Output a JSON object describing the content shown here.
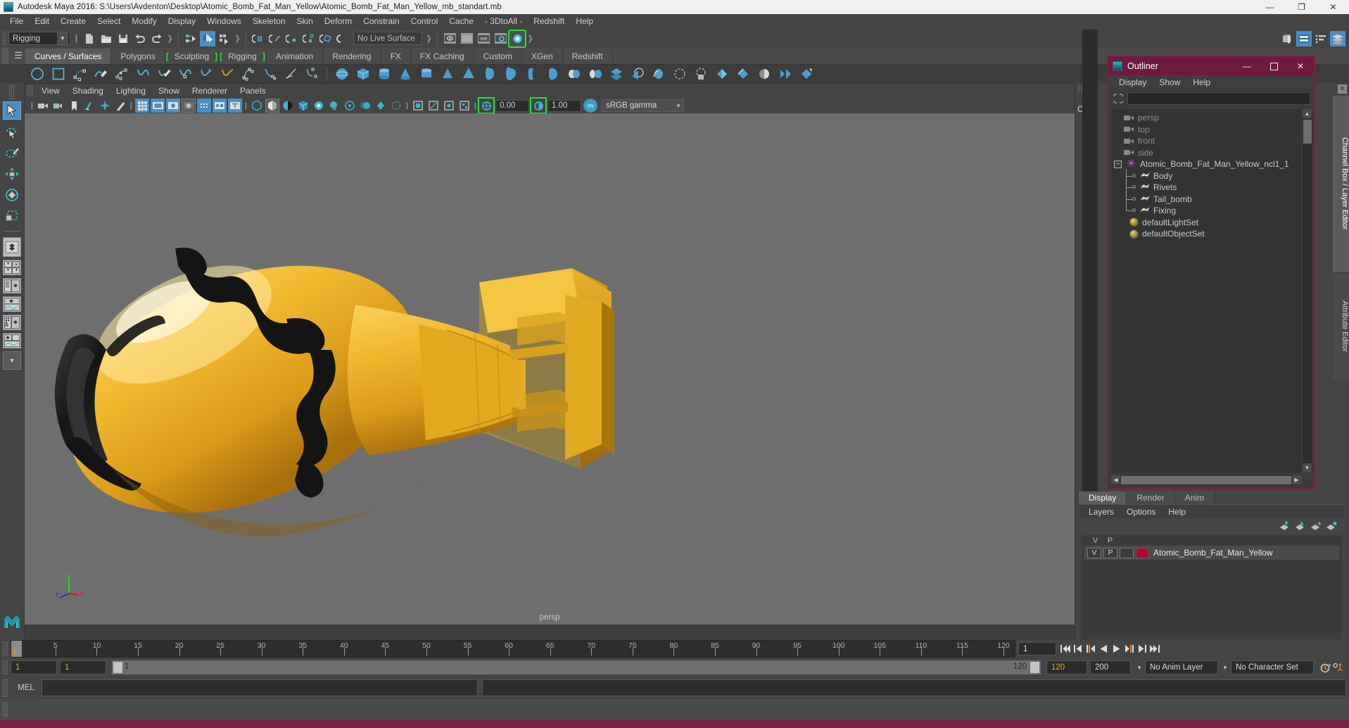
{
  "window": {
    "title": "Autodesk Maya 2016: S:\\Users\\Avdenton\\Desktop\\Atomic_Bomb_Fat_Man_Yellow\\Atomic_Bomb_Fat_Man_Yellow_mb_standart.mb",
    "icon": "maya-logo-icon",
    "minimize": "—",
    "restore": "❐",
    "close": "✕"
  },
  "menubar": {
    "items": [
      {
        "label": "File"
      },
      {
        "label": "Edit"
      },
      {
        "label": "Create"
      },
      {
        "label": "Select"
      },
      {
        "label": "Modify"
      },
      {
        "label": "Display"
      },
      {
        "label": "Windows"
      },
      {
        "label": "Skeleton"
      },
      {
        "label": "Skin"
      },
      {
        "label": "Deform"
      },
      {
        "label": "Constrain"
      },
      {
        "label": "Control"
      },
      {
        "label": "Cache"
      },
      {
        "label": "- 3DtoAll -"
      },
      {
        "label": "Redshift"
      },
      {
        "label": "Help"
      }
    ]
  },
  "toolbar": {
    "menuset": "Rigging",
    "live_surface": "No Live Surface",
    "icons": [
      "new-scene-icon",
      "open-scene-icon",
      "save-scene-icon",
      "undo-icon",
      "redo-icon",
      "select-by-hierarchy-icon",
      "select-by-object-icon",
      "select-by-component-icon",
      "snap-to-grid-icon",
      "snap-to-curve-icon",
      "snap-to-point-icon",
      "snap-to-projected-center-icon",
      "snap-to-view-plane-icon",
      "make-live-icon",
      "render-view-icon",
      "render-region-icon",
      "ipr-render-icon",
      "render-settings-icon",
      "hypershade-icon",
      "show-hide-editors-icon",
      "channel-box-toggle-icon",
      "attribute-editor-toggle-icon",
      "tool-settings-icon"
    ]
  },
  "shelf": {
    "tabs": [
      {
        "label": "Curves / Surfaces",
        "active": true,
        "bracket": false
      },
      {
        "label": "Polygons",
        "active": false,
        "bracket": false
      },
      {
        "label": "Sculpting",
        "active": false,
        "bracket": true
      },
      {
        "label": "Rigging",
        "active": false,
        "bracket": true
      },
      {
        "label": "Animation",
        "active": false,
        "bracket": false
      },
      {
        "label": "Rendering",
        "active": false,
        "bracket": false
      },
      {
        "label": "FX",
        "active": false,
        "bracket": false
      },
      {
        "label": "FX Caching",
        "active": false,
        "bracket": false
      },
      {
        "label": "Custom",
        "active": false,
        "bracket": false
      },
      {
        "label": "XGen",
        "active": false,
        "bracket": false
      },
      {
        "label": "Redshift",
        "active": false,
        "bracket": false
      }
    ],
    "icons": [
      "nurbs-circle-icon",
      "nurbs-square-icon",
      "cv-curve-icon",
      "pencil-curve-icon",
      "ep-curve-icon",
      "bezier-curve-icon",
      "arc-tool-icon",
      "curve-edit-icon",
      "attach-curves-icon",
      "detach-curves-icon",
      "open-close-curve-icon",
      "offset-curve-icon",
      "rebuild-curve-icon",
      "cut-curve-icon",
      "insert-knot-icon",
      "nurbs-sphere-icon",
      "nurbs-cube-icon",
      "nurbs-cylinder-icon",
      "nurbs-cone-icon",
      "nurbs-plane-icon",
      "nurbs-torus-icon",
      "nurbs-circle2-icon",
      "nurbs-square2-icon",
      "revolve-icon",
      "loft-icon",
      "planar-icon",
      "extrude-icon",
      "birail-icon",
      "boundary-icon",
      "square-surface-icon",
      "bevel-icon",
      "bevel-plus-icon",
      "intersect-surfaces-icon",
      "project-curve-icon",
      "trim-tool-icon",
      "untrim-icon",
      "attach-surfaces-icon",
      "detach-surfaces-icon",
      "align-surfaces-icon"
    ]
  },
  "toolbox": {
    "tools": [
      {
        "name": "select-tool",
        "active": true
      },
      {
        "name": "lasso-select-tool",
        "active": false
      },
      {
        "name": "paint-select-tool",
        "active": false
      },
      {
        "name": "move-tool",
        "active": false
      },
      {
        "name": "rotate-tool",
        "active": false
      },
      {
        "name": "scale-tool",
        "active": false
      }
    ],
    "layouts": [
      "single-perspective-layout",
      "four-view-layout",
      "outliner-persp-layout",
      "persp-graph-layout",
      "hypershade-persp-layout",
      "persp-graph-two-layout",
      "more-layouts-dropdown"
    ]
  },
  "viewport": {
    "menus": [
      {
        "label": "View"
      },
      {
        "label": "Shading"
      },
      {
        "label": "Lighting"
      },
      {
        "label": "Show"
      },
      {
        "label": "Renderer"
      },
      {
        "label": "Panels"
      }
    ],
    "camera_label": "persp",
    "exposure": "0.00",
    "gamma": "1.00",
    "color_management": "sRGB gamma",
    "axis": {
      "x": "x",
      "y": "y",
      "z": "z"
    },
    "icons": [
      "select-camera-icon",
      "camera-attributes-icon",
      "bookmark-icon",
      "image-plane-icon",
      "2d-pan-zoom-icon",
      "grease-pencil-icon",
      "grid-toggle-icon",
      "film-gate-icon",
      "resolution-gate-icon",
      "gate-mask-icon",
      "film-origin-icon",
      "safe-action-icon",
      "field-chart-icon",
      "wireframe-icon",
      "smooth-shade-icon",
      "shade-options-icon",
      "textured-icon",
      "use-all-lights-icon",
      "shadows-icon",
      "screen-space-ao-icon",
      "motion-blur-icon",
      "multisample-aa-icon",
      "depth-of-field-icon",
      "isolate-select-icon",
      "xray-icon",
      "xray-joints-icon",
      "xray-active-components-icon",
      "exposure-icon",
      "gamma-icon",
      "color-management-toggle-icon"
    ],
    "object": {
      "name": "Atomic_Bomb_Fat_Man_Yellow",
      "body_color": "#f0b428",
      "stripe_color": "#1a1a1a",
      "background": "#6e6e6e"
    }
  },
  "outliner": {
    "title": "Outliner",
    "icon": "maya-logo-icon",
    "minimize": "—",
    "maximize": "❐",
    "close": "✕",
    "menus": [
      {
        "label": "Display"
      },
      {
        "label": "Show"
      },
      {
        "label": "Help"
      }
    ],
    "search_placeholder": "",
    "search_value": "",
    "tree": [
      {
        "label": "persp",
        "type": "camera",
        "depth": 1,
        "dim": true
      },
      {
        "label": "top",
        "type": "camera",
        "depth": 1,
        "dim": true
      },
      {
        "label": "front",
        "type": "camera",
        "depth": 1,
        "dim": true
      },
      {
        "label": "side",
        "type": "camera",
        "depth": 1,
        "dim": true
      },
      {
        "label": "Atomic_Bomb_Fat_Man_Yellow_ncl1_1",
        "type": "group",
        "depth": 0,
        "dim": false,
        "expanded": true
      },
      {
        "label": "Body",
        "type": "mesh",
        "depth": 2,
        "dim": false
      },
      {
        "label": "Rivets",
        "type": "mesh",
        "depth": 2,
        "dim": false
      },
      {
        "label": "Tail_bomb",
        "type": "mesh",
        "depth": 2,
        "dim": false
      },
      {
        "label": "Fixing",
        "type": "mesh",
        "depth": 2,
        "dim": false
      },
      {
        "label": "defaultLightSet",
        "type": "set",
        "depth": 1,
        "dim": false
      },
      {
        "label": "defaultObjectSet",
        "type": "set",
        "depth": 1,
        "dim": false
      }
    ]
  },
  "channelbox": {
    "label": "Chan"
  },
  "right_tabs": [
    {
      "label": "Channel Box / Layer Editor",
      "active": true
    },
    {
      "label": "Attribute Editor",
      "active": false
    }
  ],
  "layer_editor": {
    "tabs": [
      {
        "label": "Display",
        "active": true
      },
      {
        "label": "Render",
        "active": false
      },
      {
        "label": "Anim",
        "active": false
      }
    ],
    "menus": [
      {
        "label": "Layers"
      },
      {
        "label": "Options"
      },
      {
        "label": "Help"
      }
    ],
    "buttons": [
      "move-layer-up-icon",
      "move-layer-down-icon",
      "new-layer-icon",
      "new-layer-from-selected-icon"
    ],
    "columns": [
      "V",
      "P"
    ],
    "rows": [
      {
        "visible": "V",
        "playback": "P",
        "shading": "",
        "color": "#b3052c",
        "name": "Atomic_Bomb_Fat_Man_Yellow"
      }
    ]
  },
  "timeslider": {
    "start": 1,
    "end": 120,
    "current": "1",
    "ticks": [
      5,
      10,
      15,
      20,
      25,
      30,
      35,
      40,
      45,
      50,
      55,
      60,
      65,
      70,
      75,
      80,
      85,
      90,
      95,
      100,
      105,
      110,
      115,
      120
    ],
    "cursor_label": "1",
    "playback_buttons": [
      "go-to-start-icon",
      "step-back-keyframe-icon",
      "step-back-frame-icon",
      "play-backwards-icon",
      "play-forwards-icon",
      "step-forward-frame-icon",
      "step-forward-keyframe-icon",
      "go-to-end-icon"
    ]
  },
  "rangeslider": {
    "anim_start": "1",
    "range_start": "1",
    "slider_min": "1",
    "slider_max": "120",
    "range_end": "120",
    "anim_end": "200",
    "anim_layer": "No Anim Layer",
    "character_set": "No Character Set",
    "icons": [
      "auto-keyframe-icon",
      "animation-preferences-icon"
    ]
  },
  "commandline": {
    "language": "MEL",
    "input_value": "",
    "output_value": "",
    "help_text": ""
  },
  "colors": {
    "accent_blue": "#4b8ec4",
    "green_highlight": "#29e03b",
    "outliner_maroon": "#6e1a3e",
    "orange": "#f0a030",
    "layer_swatch": "#b3052c"
  }
}
